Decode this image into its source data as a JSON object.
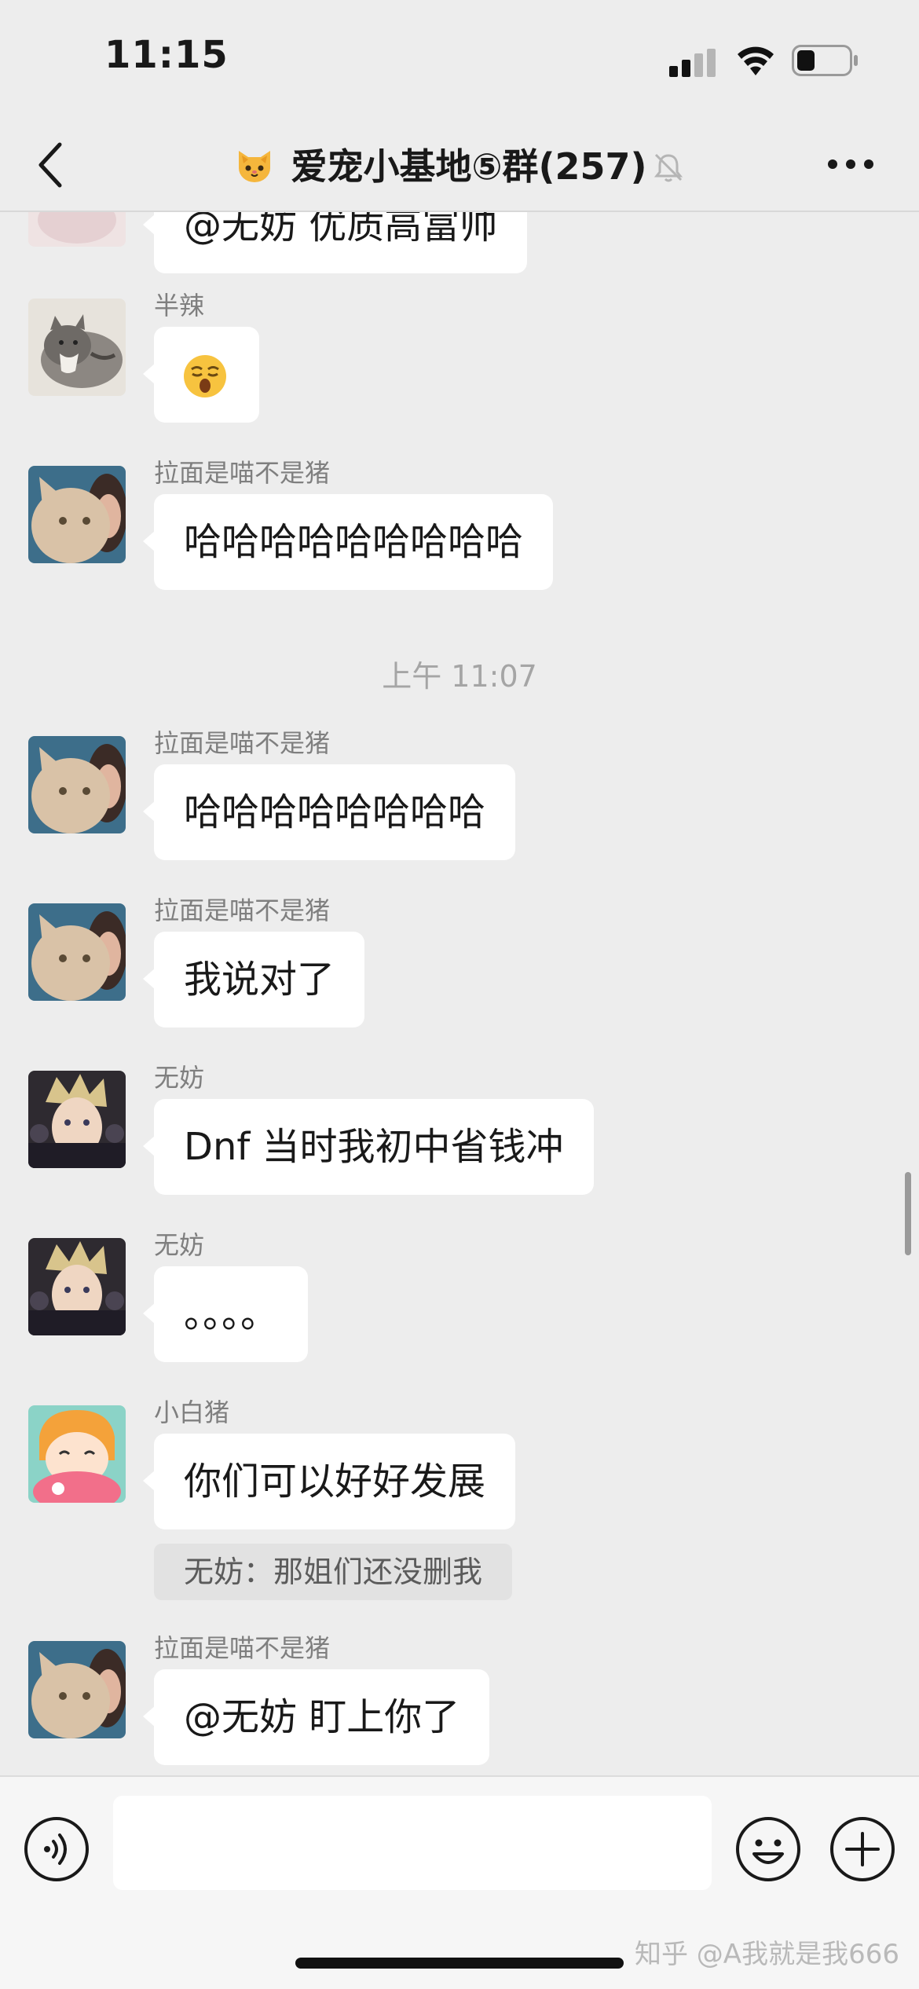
{
  "status_bar": {
    "time": "11:15",
    "battery_level": 0.35
  },
  "header": {
    "group_emoji": "cat-face",
    "title": "爱宠小基地⑤群",
    "member_count": "(257)",
    "muted": true,
    "back_icon": "chevron-left-icon",
    "more_icon": "ellipsis-icon"
  },
  "chat": {
    "partial_top_text": "@无妨 优质高富帅",
    "messages": [
      {
        "sender": "半辣",
        "text": "",
        "sticker": "yawning-face-emoji"
      },
      {
        "sender": "拉面是喵不是猪",
        "text": "哈哈哈哈哈哈哈哈哈"
      },
      {
        "sender": "拉面是喵不是猪",
        "text": "哈哈哈哈哈哈哈哈"
      },
      {
        "sender": "拉面是喵不是猪",
        "text": "我说对了"
      },
      {
        "sender": "无妨",
        "text": "Dnf 当时我初中省钱冲"
      },
      {
        "sender": "无妨",
        "text": "。。。。"
      },
      {
        "sender": "小白猪",
        "text": "你们可以好好发展",
        "quote": "无妨：那姐们还没删我"
      },
      {
        "sender": "拉面是喵不是猪",
        "text": "@无妨 盯上你了"
      }
    ],
    "timestamp": "上午 11:07"
  },
  "input_bar": {
    "placeholder": "",
    "voice_icon": "voice-icon",
    "emoji_icon": "emoji-icon",
    "plus_icon": "plus-icon"
  },
  "watermark": "知乎 @A我就是我666",
  "colors": {
    "background": "#ededed",
    "bubble": "#ffffff",
    "quote_bg": "#e2e2e2",
    "sender_text": "#7f7f7f",
    "timestamp_text": "#a5a5a5"
  }
}
